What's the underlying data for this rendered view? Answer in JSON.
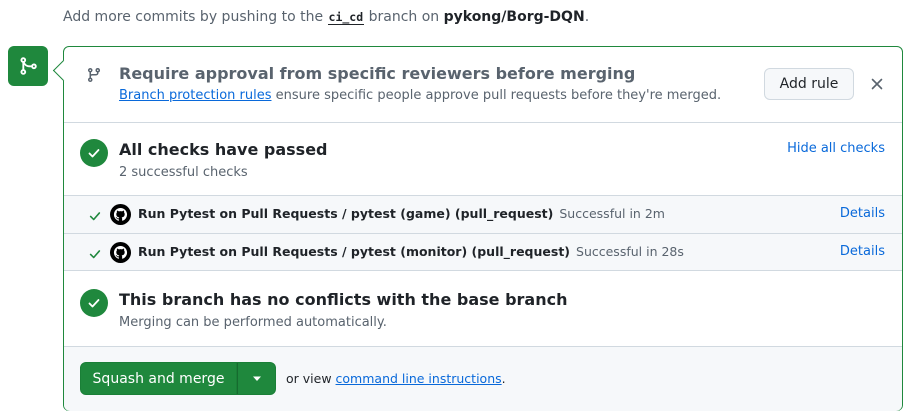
{
  "intro": {
    "prefix": "Add more commits by pushing to the",
    "branch": "ci_cd",
    "middle": "branch on",
    "repo": "pykong/Borg-DQN",
    "suffix": "."
  },
  "approval": {
    "title": "Require approval from specific reviewers before merging",
    "link": "Branch protection rules",
    "desc": "ensure specific people approve pull requests before they're merged.",
    "add_rule": "Add rule"
  },
  "checks": {
    "title": "All checks have passed",
    "subtitle": "2 successful checks",
    "hide_all": "Hide all checks",
    "items": [
      {
        "name": "Run Pytest on Pull Requests / pytest (game) (pull_request)",
        "status": "Successful in 2m",
        "details": "Details"
      },
      {
        "name": "Run Pytest on Pull Requests / pytest (monitor) (pull_request)",
        "status": "Successful in 28s",
        "details": "Details"
      }
    ]
  },
  "conflicts": {
    "title": "This branch has no conflicts with the base branch",
    "subtitle": "Merging can be performed automatically."
  },
  "merge": {
    "button": "Squash and merge",
    "or_view": "or view",
    "cli_link": "command line instructions",
    "suffix": "."
  },
  "colors": {
    "success": "#1f883d",
    "link": "#0969da",
    "muted": "#59636e"
  }
}
